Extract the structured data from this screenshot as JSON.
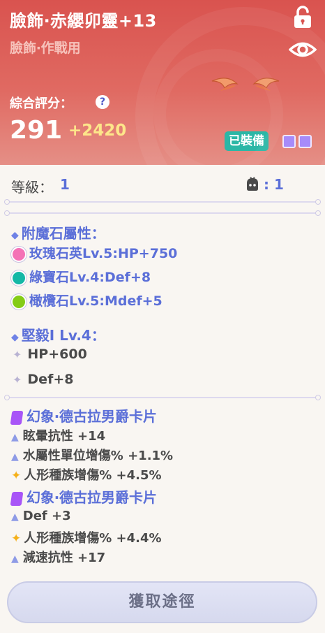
{
  "header": {
    "item_name": "臉飾‧赤纓卯靈+13",
    "item_type": "臉飾‧作戰用",
    "score_label": "綜合評分：",
    "help_glyph": "?",
    "score_value": "291",
    "score_bonus": "+2420",
    "equipped_label": "已裝備",
    "lock_icon": "unlock-icon",
    "view_icon": "eye-icon",
    "accent": "#d9534f"
  },
  "level": {
    "label": "等級：",
    "value": "1",
    "slot_count": ": 1"
  },
  "enchant": {
    "title": "附魔石屬性：",
    "gems": [
      {
        "text": "玫瑰石英Lv.5:HP+750",
        "icon": "rose-quartz-gem-icon",
        "color": "#f472b6"
      },
      {
        "text": "綠寶石Lv.4:Def+8",
        "icon": "emerald-gem-icon",
        "color": "#14b8a6"
      },
      {
        "text": "橄欖石Lv.5:Mdef+5",
        "icon": "peridot-gem-icon",
        "color": "#84cc16"
      }
    ]
  },
  "skill": {
    "title": "堅毅I Lv.4：",
    "stats": [
      "HP+600",
      "Def+8"
    ]
  },
  "cards": [
    {
      "title": "幻象‧德古拉男爵卡片",
      "stats": [
        {
          "text": "眩暈抗性 +14",
          "icon": "triangle"
        },
        {
          "text": "水屬性單位增傷% +1.1%",
          "icon": "triangle"
        },
        {
          "text": "人形種族增傷% +4.5%",
          "icon": "star"
        }
      ]
    },
    {
      "title": "幻象‧德古拉男爵卡片",
      "stats": [
        {
          "text": "Def +3",
          "icon": "triangle"
        },
        {
          "text": "人形種族增傷% +4.4%",
          "icon": "star"
        },
        {
          "text": "減速抗性 +17",
          "icon": "triangle"
        }
      ]
    }
  ],
  "footer": {
    "acquire_button": "獲取途徑"
  }
}
